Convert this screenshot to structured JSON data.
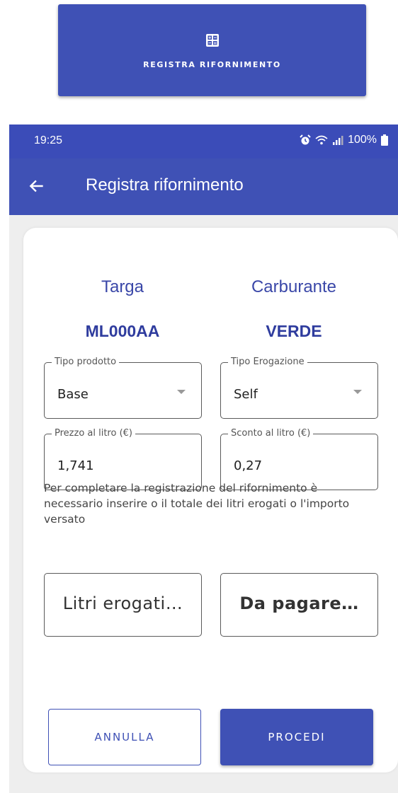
{
  "banner": {
    "label": "REGISTRA RIFORNIMENTO",
    "icon": "calculator-icon"
  },
  "status_bar": {
    "time": "19:25",
    "battery": "100%"
  },
  "app_bar": {
    "title": "Registra rifornimento"
  },
  "form": {
    "plate_header": "Targa",
    "plate_value": "ML000AA",
    "fuel_header": "Carburante",
    "fuel_value": "VERDE",
    "product_type": {
      "label": "Tipo prodotto",
      "value": "Base"
    },
    "delivery_type": {
      "label": "Tipo Erogazione",
      "value": "Self"
    },
    "price_per_liter": {
      "label": "Prezzo al litro (€)",
      "value": "1,741"
    },
    "discount_per_liter": {
      "label": "Sconto al litro (€)",
      "value": "0,27"
    },
    "info_text": "Per completare la registrazione del rifornimento è necessario inserire o il totale dei litri erogati o l'importo versato",
    "liters_placeholder": "Litri erogati…",
    "to_pay_placeholder": "Da pagare…"
  },
  "actions": {
    "cancel": "ANNULLA",
    "proceed": "PROCEDI"
  },
  "colors": {
    "primary": "#3f51b5",
    "status_bar": "#3b4cb8",
    "heading": "#3a47a8"
  }
}
